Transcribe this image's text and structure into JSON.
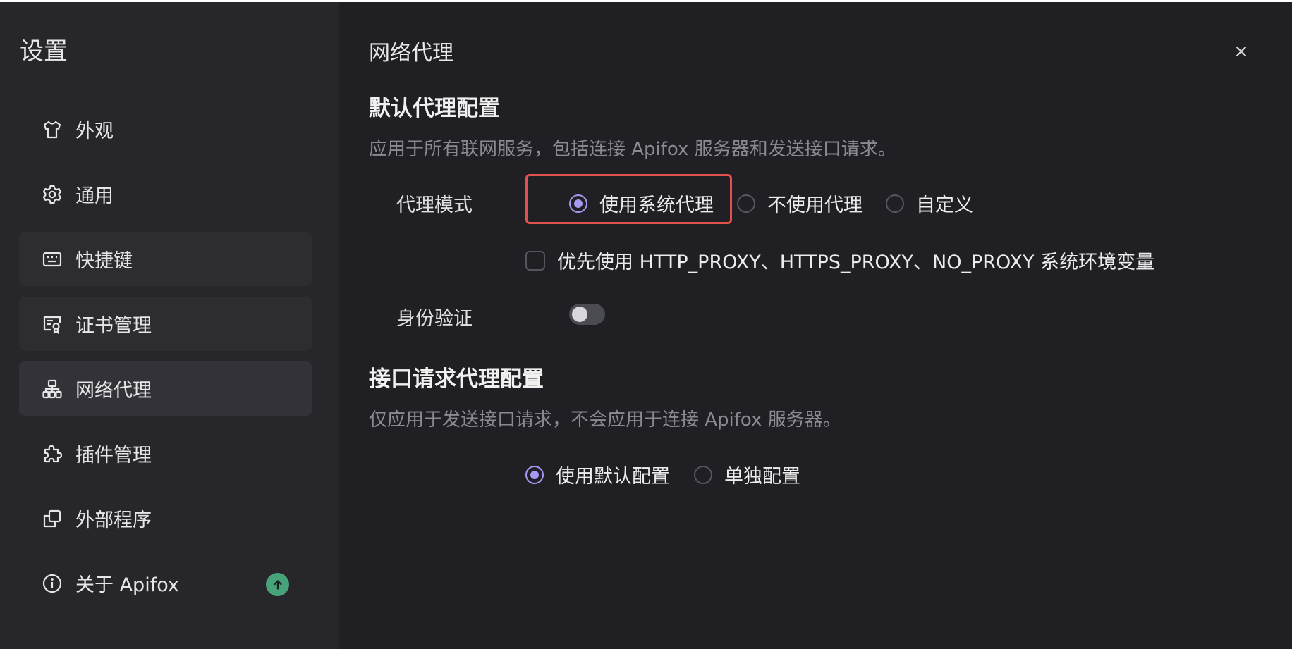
{
  "sidebar": {
    "title": "设置",
    "items": [
      {
        "label": "外观",
        "icon": "shirt-icon"
      },
      {
        "label": "通用",
        "icon": "gear-icon"
      },
      {
        "label": "快捷键",
        "icon": "keyboard-icon"
      },
      {
        "label": "证书管理",
        "icon": "certificate-icon"
      },
      {
        "label": "网络代理",
        "icon": "network-icon"
      },
      {
        "label": "插件管理",
        "icon": "puzzle-icon"
      },
      {
        "label": "外部程序",
        "icon": "external-program-icon"
      },
      {
        "label": "关于 Apifox",
        "icon": "info-icon"
      }
    ],
    "active_item": "网络代理"
  },
  "main": {
    "page_title": "网络代理",
    "default_proxy": {
      "title": "默认代理配置",
      "description": "应用于所有联网服务，包括连接 Apifox 服务器和发送接口请求。",
      "mode_label": "代理模式",
      "mode_options": [
        "使用系统代理",
        "不使用代理",
        "自定义"
      ],
      "mode_selected": "使用系统代理",
      "env_checkbox_label": "优先使用 HTTP_PROXY、HTTPS_PROXY、NO_PROXY 系统环境变量",
      "env_checkbox_checked": false,
      "auth_label": "身份验证",
      "auth_enabled": false
    },
    "request_proxy": {
      "title": "接口请求代理配置",
      "description": "仅应用于发送接口请求，不会应用于连接 Apifox 服务器。",
      "options": [
        "使用默认配置",
        "单独配置"
      ],
      "selected": "使用默认配置"
    }
  },
  "colors": {
    "accent": "#a898f2",
    "highlight_border": "#e0524a",
    "update_badge": "#46a37a",
    "background": "#202024",
    "sidebar_background": "#26262b"
  }
}
